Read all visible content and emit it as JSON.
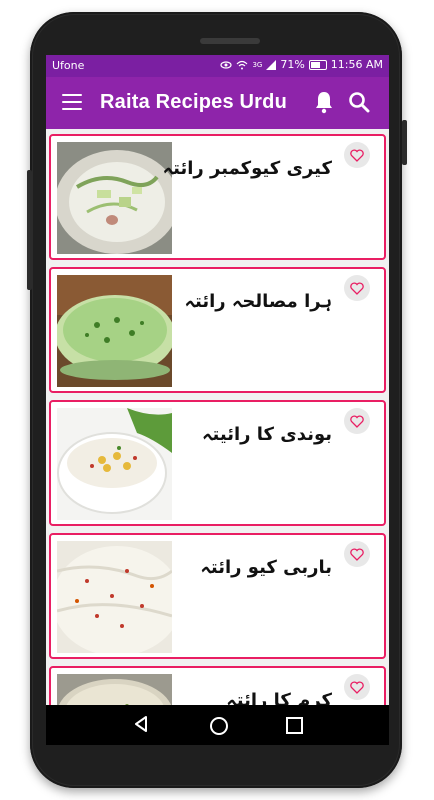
{
  "status_bar": {
    "carrier": "Ufone",
    "network": "3G",
    "battery": "71%",
    "time": "11:56 AM"
  },
  "app_bar": {
    "title": "Raita Recipes Urdu",
    "menu_icon": "hamburger-menu-icon",
    "notification_icon": "bell-icon",
    "search_icon": "search-icon",
    "color": "#8e24aa"
  },
  "status_bar_color": "#7b1fa2",
  "card_border_color": "#e91e63",
  "recipes": [
    {
      "title": "کیری کیوکمبر رائتہ",
      "thumb_icon": "raita-cucumber-image"
    },
    {
      "title": "ہرا مصالحہ رائتہ",
      "thumb_icon": "green-raita-image"
    },
    {
      "title": "بوندی کا رائیتہ",
      "thumb_icon": "boondi-raita-image"
    },
    {
      "title": "باربی کیو رائتہ",
      "thumb_icon": "bbq-raita-image"
    },
    {
      "title": "کرم کا رائتہ",
      "thumb_icon": "raita-bowl-image"
    }
  ]
}
